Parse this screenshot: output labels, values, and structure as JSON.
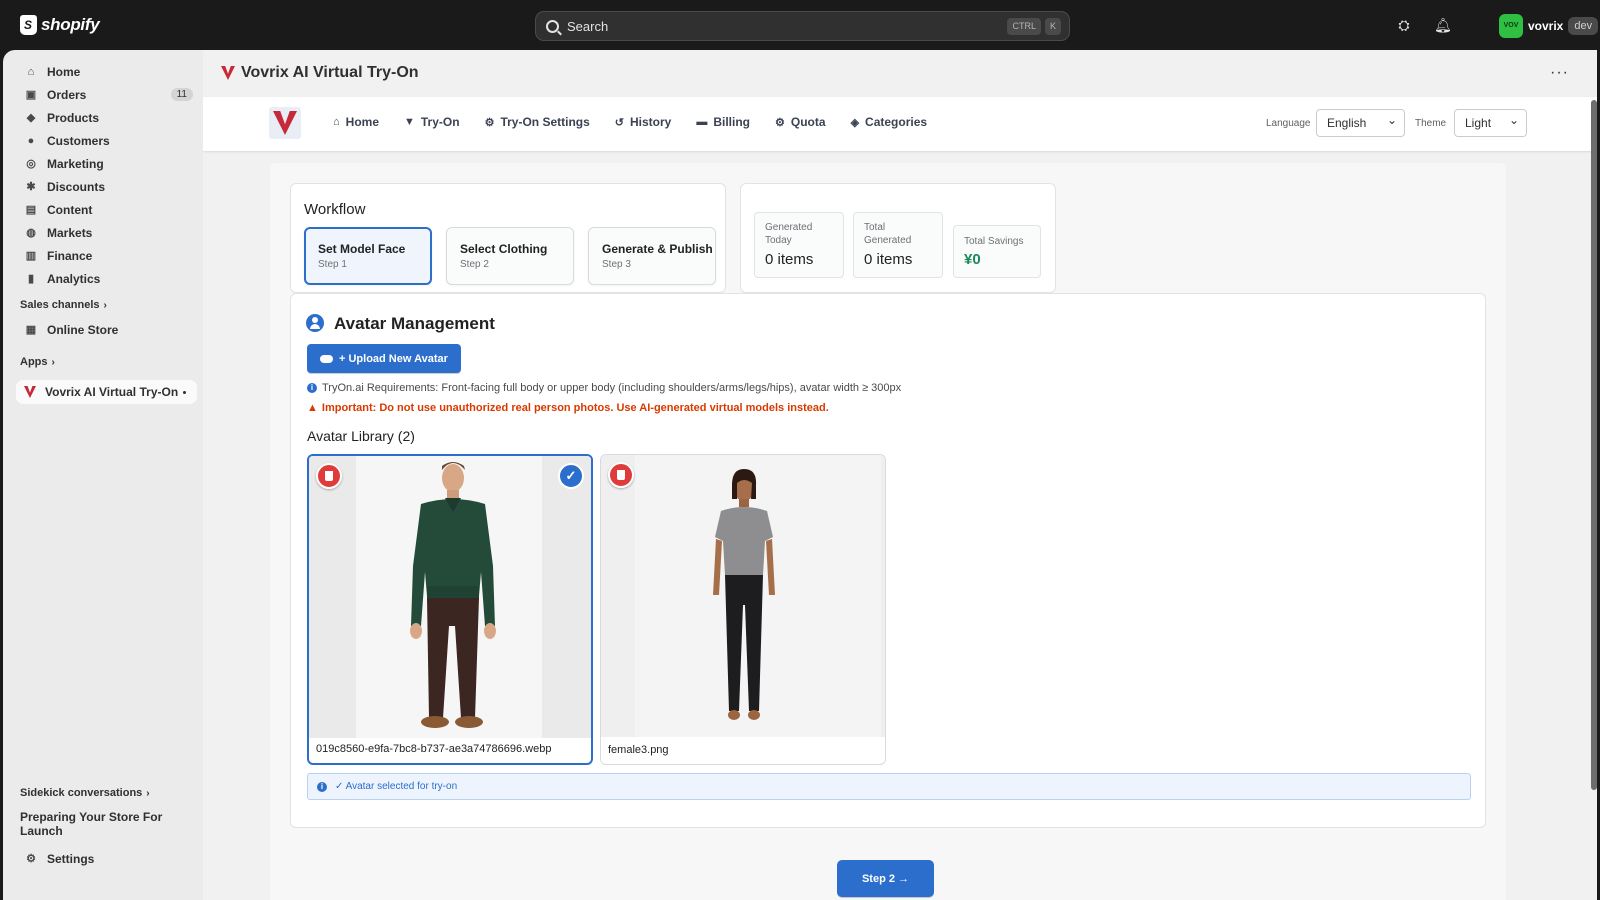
{
  "topbar": {
    "logo_text": "shopify",
    "search_placeholder": "Search",
    "kbd1": "CTRL",
    "kbd2": "K",
    "store_avatar": "VOV",
    "store_name": "vovrix",
    "store_badge": "dev"
  },
  "sidebar": {
    "items": [
      {
        "label": "Home",
        "icon": "home-icon"
      },
      {
        "label": "Orders",
        "icon": "orders-icon",
        "count": "11"
      },
      {
        "label": "Products",
        "icon": "tag-icon"
      },
      {
        "label": "Customers",
        "icon": "person-icon"
      },
      {
        "label": "Marketing",
        "icon": "target-icon"
      },
      {
        "label": "Discounts",
        "icon": "discount-icon"
      },
      {
        "label": "Content",
        "icon": "content-icon"
      },
      {
        "label": "Markets",
        "icon": "globe-icon"
      },
      {
        "label": "Finance",
        "icon": "bank-icon"
      },
      {
        "label": "Analytics",
        "icon": "chart-icon"
      }
    ],
    "sales_channels": "Sales channels",
    "online_store": "Online Store",
    "apps": "Apps",
    "app_item": "Vovrix AI Virtual Try-On",
    "sidekick": "Sidekick conversations",
    "preparing": "Preparing Your Store For Launch",
    "settings": "Settings"
  },
  "page": {
    "title": "Vovrix AI Virtual Try-On",
    "more": "···"
  },
  "appnav": {
    "items": [
      {
        "label": "Home",
        "icon": "home-icon"
      },
      {
        "label": "Try-On",
        "icon": "shirt-icon"
      },
      {
        "label": "Try-On Settings",
        "icon": "gear-icon"
      },
      {
        "label": "History",
        "icon": "history-icon"
      },
      {
        "label": "Billing",
        "icon": "card-icon"
      },
      {
        "label": "Quota",
        "icon": "gear-icon"
      },
      {
        "label": "Categories",
        "icon": "tags-icon"
      }
    ],
    "language_label": "Language",
    "language_value": "English",
    "theme_label": "Theme",
    "theme_value": "Light"
  },
  "workflow": {
    "title": "Workflow",
    "steps": [
      {
        "title": "Set Model Face",
        "sub": "Step 1"
      },
      {
        "title": "Select Clothing",
        "sub": "Step 2"
      },
      {
        "title": "Generate & Publish",
        "sub": "Step 3"
      }
    ]
  },
  "stats": [
    {
      "label": "Generated Today",
      "value": "0 items"
    },
    {
      "label": "Total Generated",
      "value": "0 items"
    },
    {
      "label": "Total Savings",
      "value": "¥0"
    }
  ],
  "avatar": {
    "title": "Avatar Management",
    "upload_label": "+ Upload New Avatar",
    "requirements": "TryOn.ai Requirements: Front-facing full body or upper body (including shoulders/arms/legs/hips), avatar width ≥ 300px",
    "warning": "Important: Do not use unauthorized real person photos. Use AI-generated virtual models instead.",
    "library_title": "Avatar Library (2)",
    "items": [
      {
        "file": "019c8560-e9fa-7bc8-b737-ae3a74786696.webp",
        "selected": true
      },
      {
        "file": "female3.png",
        "selected": false
      }
    ],
    "selected_note": "✓ Avatar selected for try-on",
    "next_label": "Step 2 →"
  },
  "colors": {
    "accent": "#2c6ecb",
    "danger": "#e03b3b",
    "warning": "#d83a00",
    "savings": "#1a8a5a"
  }
}
